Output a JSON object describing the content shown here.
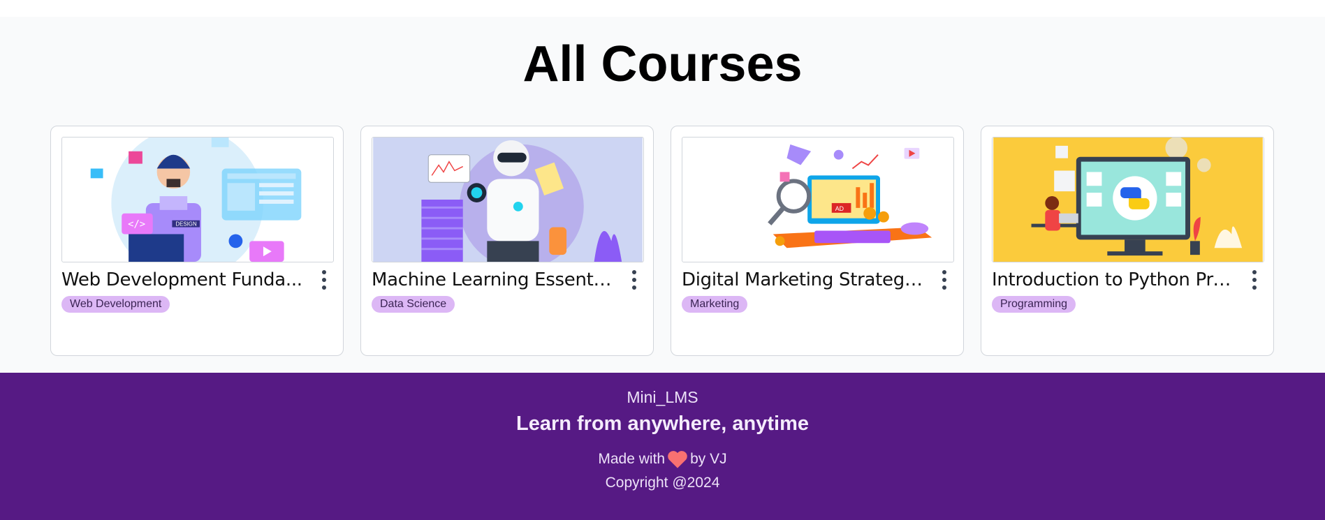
{
  "page": {
    "title": "All Courses"
  },
  "courses": [
    {
      "title": "Web Development Funda...",
      "category": "Web Development",
      "image": "web-dev-illustration"
    },
    {
      "title": "Machine Learning Essentials",
      "category": "Data Science",
      "image": "robot-illustration"
    },
    {
      "title": "Digital Marketing Strategies",
      "category": "Marketing",
      "image": "marketing-illustration"
    },
    {
      "title": "Introduction to Python Pro...",
      "category": "Programming",
      "image": "python-illustration"
    }
  ],
  "footer": {
    "brand": "Mini_LMS",
    "tagline": "Learn from anywhere, anytime",
    "made_prefix": "Made with",
    "made_suffix": "by VJ",
    "copyright": "Copyright @2024"
  },
  "colors": {
    "footer_bg": "#561a84",
    "tag_bg": "#dcb7f5",
    "heart": "#f87171"
  }
}
